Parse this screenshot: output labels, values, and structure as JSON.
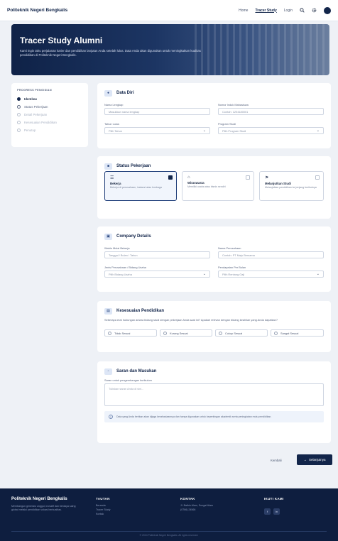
{
  "nav": {
    "brand": "Politeknik Negeri Bengkalis",
    "links": [
      "Home",
      "Tracer Study",
      "Login"
    ],
    "active_link": "Tracer Study"
  },
  "hero": {
    "title": "Tracer Study Alumni",
    "description": "Kami ingin tahu perjalanan karier dan pendidikan lanjutan Anda setelah lulus. Data Anda akan digunakan untuk meningkatkan kualitas pendidikan di Politeknik Negeri Bengkalis."
  },
  "stepper": {
    "title": "PROGRESS PENGISIAN",
    "steps": [
      {
        "label": "Identitas",
        "state": "done"
      },
      {
        "label": "Status Pekerjaan",
        "state": "current"
      },
      {
        "label": "Detail Pekerjaan",
        "state": "pending"
      },
      {
        "label": "Kesesuaian Pendidikan",
        "state": "pending"
      },
      {
        "label": "Penutup",
        "state": "pending"
      }
    ]
  },
  "data_diri": {
    "title": "Data Diri",
    "name_label": "Nama Lengkap",
    "name_placeholder": "Masukkan nama lengkap",
    "nim_label": "Nomor Induk Mahasiswa",
    "nim_placeholder": "Contoh: 1204180001",
    "year_label": "Tahun Lulus",
    "year_value": "Pilih Tahun",
    "prodi_label": "Program Studi",
    "prodi_value": "Pilih Program Studi"
  },
  "status": {
    "title": "Status Pekerjaan",
    "options": [
      {
        "icon": "briefcase-icon",
        "glyph": "☰",
        "name": "Bekerja",
        "desc": "Bekerja di perusahaan, instansi atau lembaga",
        "selected": true
      },
      {
        "icon": "store-icon",
        "glyph": "⌂",
        "name": "Wiraswasta",
        "desc": "Memiliki usaha atau bisnis sendiri",
        "selected": false
      },
      {
        "icon": "graduation-icon",
        "glyph": "⚑",
        "name": "Melanjutkan Studi",
        "desc": "Melanjutkan pendidikan ke jenjang berikutnya",
        "selected": false
      }
    ]
  },
  "company": {
    "title": "Company Details",
    "start_label": "Waktu Mulai Bekerja",
    "start_value": "Tanggal / Bulan / Tahun",
    "company_label": "Nama Perusahaan",
    "company_placeholder": "Contoh: PT Maju Bersama",
    "sector_label": "Jenis Perusahaan / Bidang Usaha",
    "sector_value": "Pilih Bidang Usaha",
    "salary_label": "Pendapatan Per Bulan",
    "salary_value": "Pilih Rentang Gaji"
  },
  "kesesuaian": {
    "title": "Kesesuaian Pendidikan",
    "question": "Seberapa erat hubungan antara bidang studi dengan pekerjaan Anda saat ini? Apakah relevan dengan bidang keahlian yang Anda dapatkan?",
    "scale": [
      "Tidak Sesuai",
      "Kurang Sesuai",
      "Cukup Sesuai",
      "Sangat Sesuai"
    ]
  },
  "saran": {
    "title": "Saran dan Masukan",
    "label": "Saran untuk pengembangan kurikulum",
    "placeholder": "Tuliskan saran Anda di sini...",
    "note": "Data yang Anda berikan akan dijaga kerahasiaannya dan hanya digunakan untuk kepentingan akademik serta peningkatan mutu pendidikan."
  },
  "actions": {
    "back": "Kembali",
    "next": "Selanjutnya"
  },
  "footer": {
    "brand": "Politeknik Negeri Bengkalis",
    "desc": "Membangun generasi unggul, inovatif dan berdaya saing global melalui pendidikan vokasi berkualitas.",
    "col1_title": "TAUTAN",
    "col1_links": [
      "Beranda",
      "Tracer Study",
      "Kontak"
    ],
    "col2_title": "KONTAK",
    "col2_links": [
      "Jl. Bathin Alam, Sungai Alam",
      "(0766) 24566"
    ],
    "col3_title": "IKUTI KAMI",
    "socials": [
      "f",
      "in"
    ],
    "copyright": "© 2024 Politeknik Negeri Bengkalis. All rights reserved."
  },
  "colors": {
    "primary": "#12254a",
    "accent": "#1d3c78",
    "page_bg": "#eef1f6"
  }
}
